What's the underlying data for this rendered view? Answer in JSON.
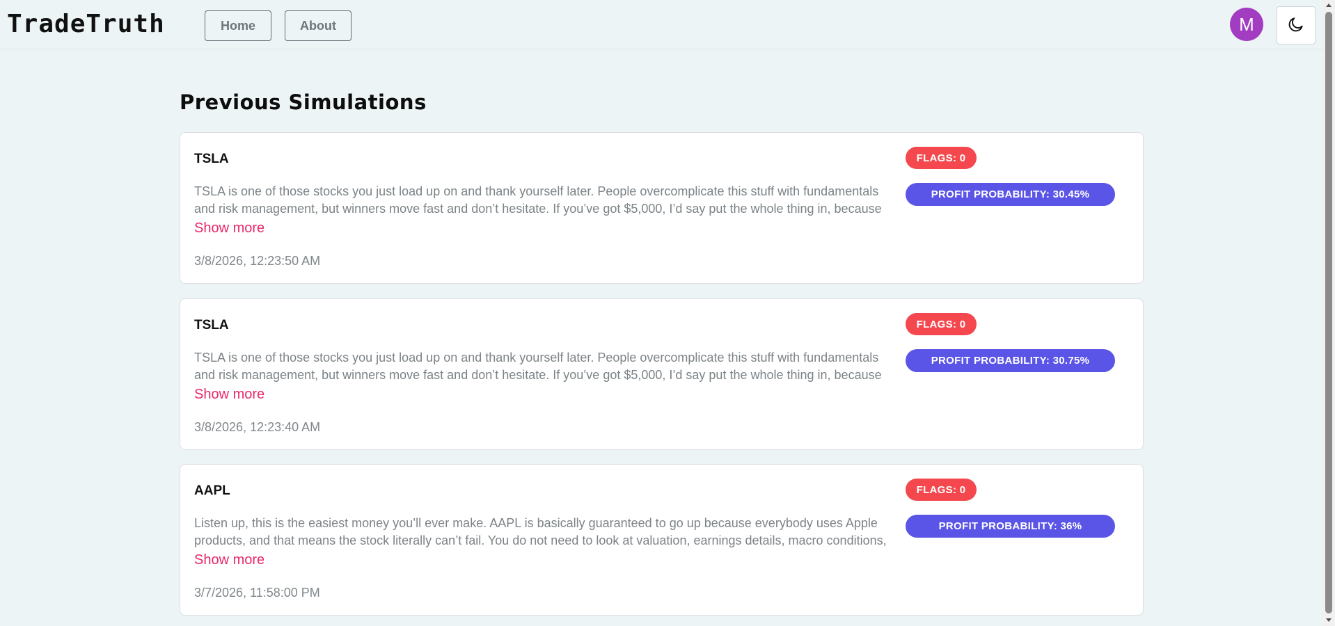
{
  "header": {
    "brand": "TradeTruth",
    "nav": [
      {
        "label": "Home"
      },
      {
        "label": "About"
      }
    ],
    "avatar_initial": "M",
    "theme_toggle_icon": "moon-icon"
  },
  "main": {
    "title": "Previous Simulations",
    "simulations": [
      {
        "ticker": "TSLA",
        "text": "TSLA is one of those stocks you just load up on and thank yourself later. People overcomplicate this stuff with fundamentals and risk management, but winners move fast and don’t hesitate. If you’ve got $5,000, I’d say put the whole thing in, because splitting",
        "show_more": "Show more",
        "timestamp": "3/8/2026, 12:23:50 AM",
        "flags": "FLAGS: 0",
        "profit_probability": "PROFIT PROBABILITY: 30.45%"
      },
      {
        "ticker": "TSLA",
        "text": "TSLA is one of those stocks you just load up on and thank yourself later. People overcomplicate this stuff with fundamentals and risk management, but winners move fast and don’t hesitate. If you’ve got $5,000, I’d say put the whole thing in, because splitting",
        "show_more": "Show more",
        "timestamp": "3/8/2026, 12:23:40 AM",
        "flags": "FLAGS: 0",
        "profit_probability": "PROFIT PROBABILITY: 30.75%"
      },
      {
        "ticker": "AAPL",
        "text": "Listen up, this is the easiest money you’ll ever make. AAPL is basically guaranteed to go up because everybody uses Apple products, and that means the stock literally can’t fail. You do not need to look at valuation, earnings details, macro conditions, or",
        "show_more": "Show more",
        "timestamp": "3/7/2026, 11:58:00 PM",
        "flags": "FLAGS: 0",
        "profit_probability": "PROFIT PROBABILITY: 36%"
      }
    ]
  },
  "colors": {
    "background": "#edf4f6",
    "flags_badge": "#f4484e",
    "probability_badge": "#5a55e6",
    "show_more_link": "#e9276b",
    "avatar": "#a23cc0"
  }
}
